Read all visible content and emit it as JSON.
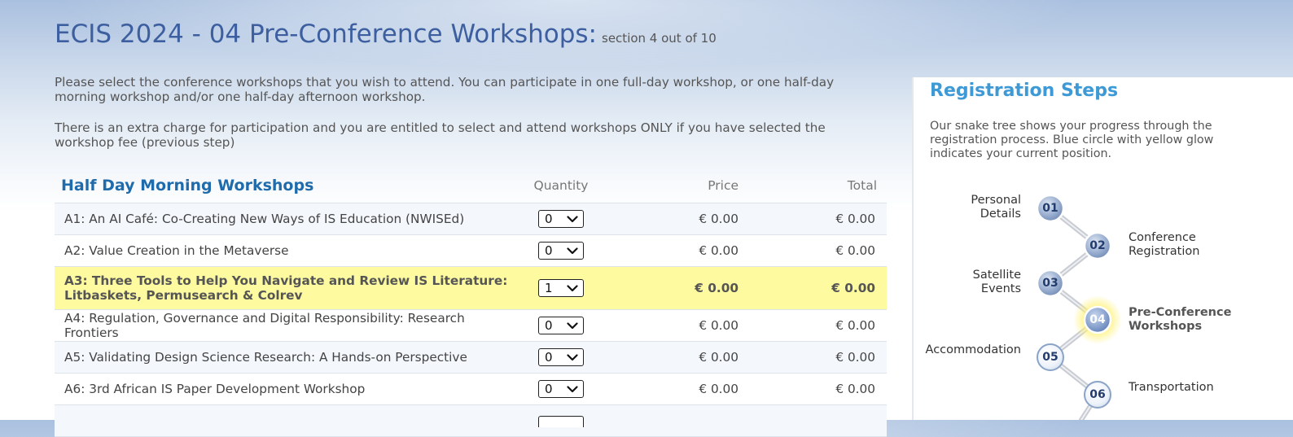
{
  "page": {
    "title": "ECIS 2024 - 04 Pre-Conference Workshops:",
    "subtitle": "section 4 out of 10",
    "intro": [
      "Please select the conference workshops that you wish to attend. You can participate in one full-day workshop, or one half-day morning workshop and/or one half-day afternoon workshop.",
      "There is an extra charge for participation and you are entitled to select and attend workshops ONLY if you have selected the workshop fee (previous step)"
    ]
  },
  "workshops": {
    "section_title": "Half Day Morning Workshops",
    "col_quantity": "Quantity",
    "col_price": "Price",
    "col_total": "Total",
    "rows": [
      {
        "name": "A1: An AI Café: Co-Creating New Ways of IS Education (NWISEd)",
        "qty": "0",
        "price": "€ 0.00",
        "total": "€ 0.00"
      },
      {
        "name": "A2: Value Creation in the Metaverse",
        "qty": "0",
        "price": "€ 0.00",
        "total": "€ 0.00"
      },
      {
        "name": "A3: Three Tools to Help You Navigate and Review IS Literature: Litbaskets, Permusearch & Colrev",
        "qty": "1",
        "price": "€ 0.00",
        "total": "€ 0.00",
        "selected": true
      },
      {
        "name": "A4: Regulation, Governance and Digital Responsibility: Research Frontiers",
        "qty": "0",
        "price": "€ 0.00",
        "total": "€ 0.00"
      },
      {
        "name": "A5: Validating Design Science Research: A Hands-on Perspective",
        "qty": "0",
        "price": "€ 0.00",
        "total": "€ 0.00"
      },
      {
        "name": "A6: 3rd African IS Paper Development Workshop",
        "qty": "0",
        "price": "€ 0.00",
        "total": "€ 0.00"
      }
    ]
  },
  "sidebar": {
    "title": "Registration Steps",
    "description": "Our snake tree shows your progress through the registration process. Blue circle with yellow glow indicates your current position.",
    "steps": [
      {
        "num": "01",
        "label": "Personal Details",
        "state": "done"
      },
      {
        "num": "02",
        "label": "Conference Registration",
        "state": "done"
      },
      {
        "num": "03",
        "label": "Satellite Events",
        "state": "done"
      },
      {
        "num": "04",
        "label": "Pre-Conference Workshops",
        "state": "current"
      },
      {
        "num": "05",
        "label": "Accommodation",
        "state": "todo"
      },
      {
        "num": "06",
        "label": "Transportation",
        "state": "todo"
      }
    ]
  },
  "colors": {
    "title": "#3d5fa0",
    "section_title": "#1f6bab",
    "sidebar_title": "#3d9ad6",
    "selected_row": "#fdfaa0",
    "current_step_glow": "#fff27a"
  }
}
